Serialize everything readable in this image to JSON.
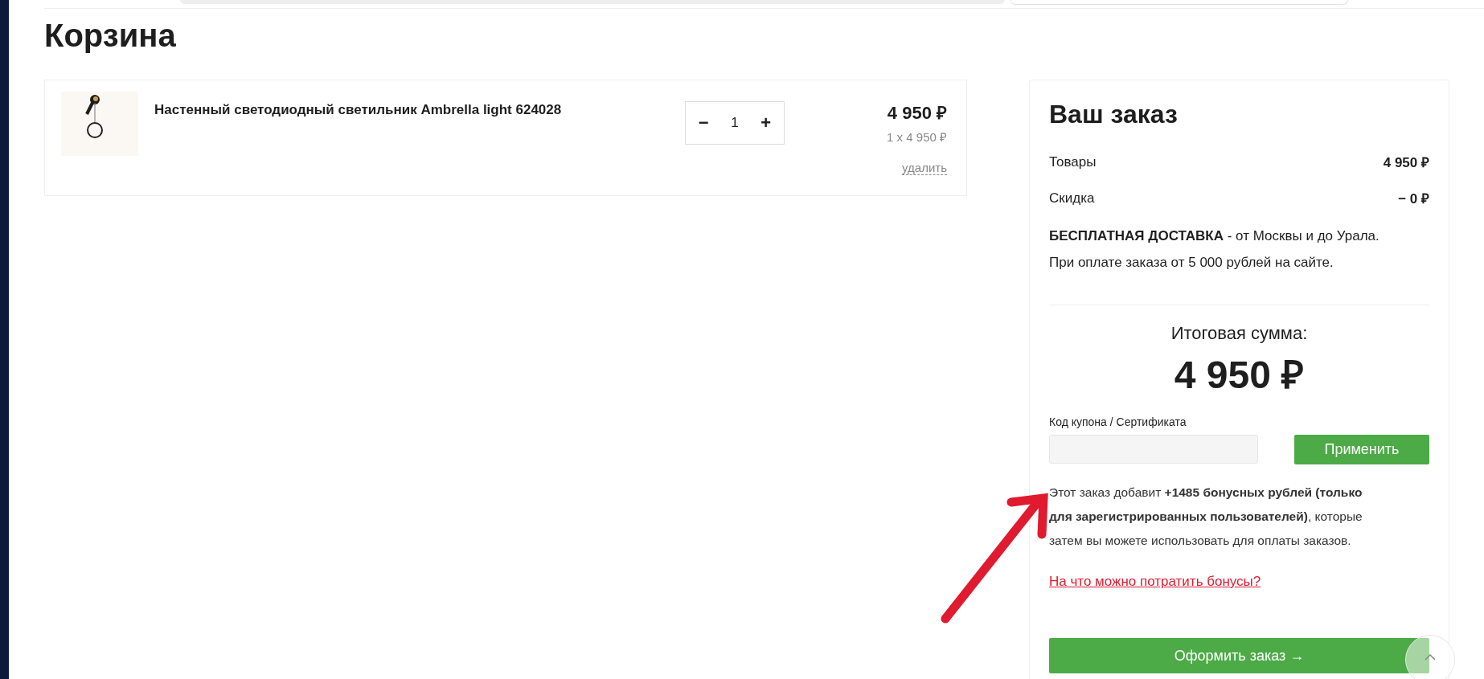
{
  "page_title": "Корзина",
  "cart_items": [
    {
      "name": "Настенный светодиодный светильник Ambrella light 624028",
      "quantity": "1",
      "minus": "−",
      "plus": "+",
      "price": "4 950 ₽",
      "unit_price": "1 x 4 950 ₽",
      "remove": "удалить"
    }
  ],
  "order": {
    "title": "Ваш заказ",
    "lines": [
      {
        "label": "Товары",
        "value": "4 950 ₽"
      },
      {
        "label": "Скидка",
        "value": "− 0 ₽"
      }
    ],
    "delivery": [
      "**БЕСПЛАТНАЯ ДОСТАВКА** - от Москвы и до Урала.",
      "При оплате заказа от 5 000 рублей на сайте."
    ],
    "total_label": "Итоговая сумма:",
    "total": "4 950 ₽",
    "coupon": {
      "label": "Код купона / Сертификата",
      "button": "Применить"
    },
    "bonus_text": "Этот заказ добавит **+1485 бонусных рублей (только для зарегистрированных пользователей)**, которые затем вы можете использовать для оплаты заказов.",
    "bonus_link": "На что можно потратить бонусы?",
    "checkout": "Оформить заказ →"
  }
}
